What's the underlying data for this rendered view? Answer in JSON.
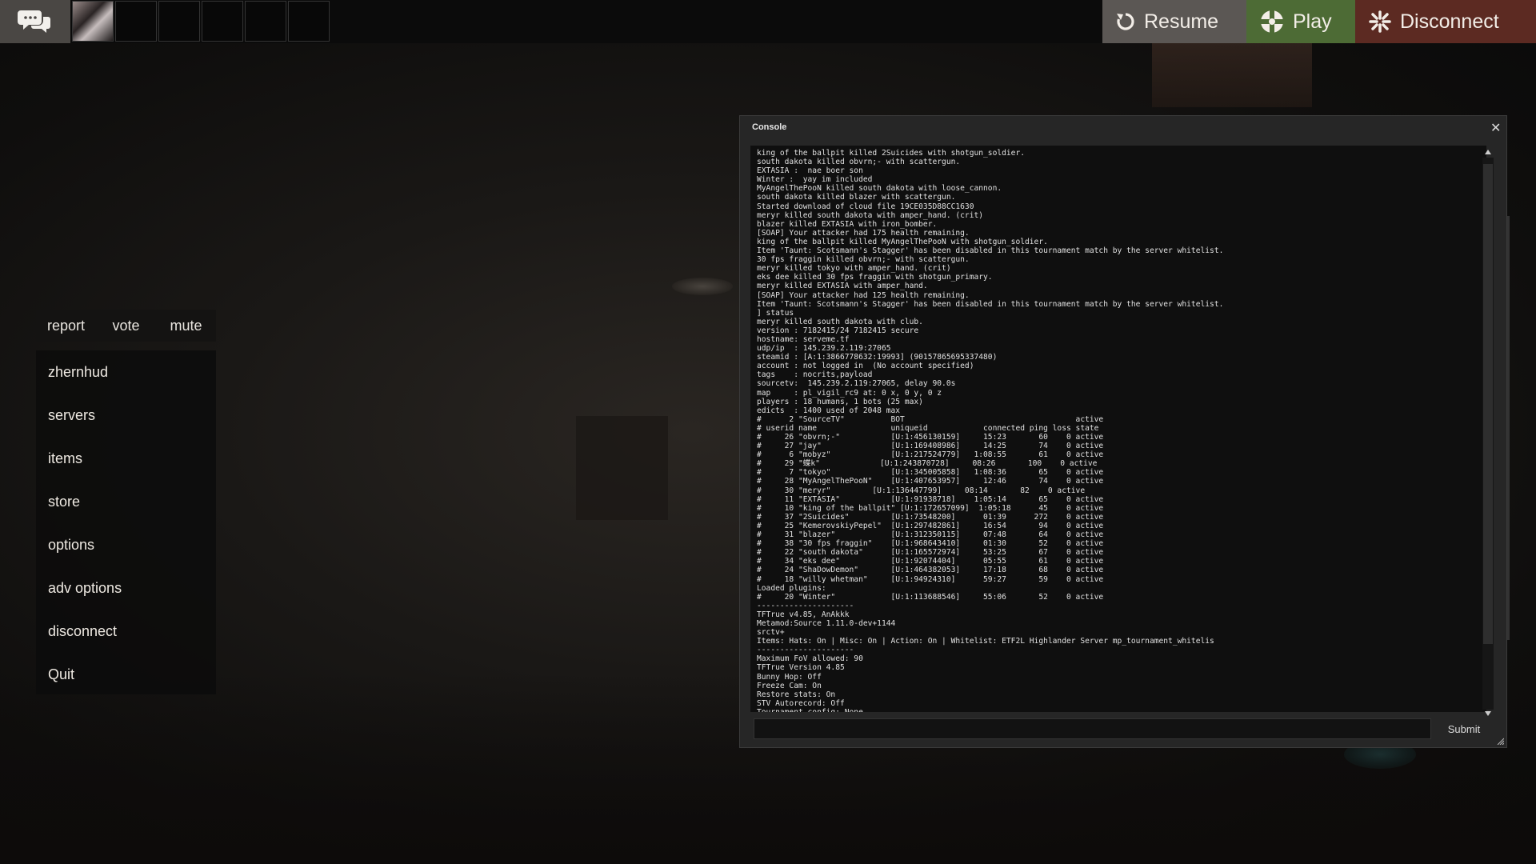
{
  "topbar": {
    "resume_label": "Resume",
    "play_label": "Play",
    "disconnect_label": "Disconnect"
  },
  "quick_actions": [
    "report",
    "vote",
    "mute"
  ],
  "menu": {
    "items": [
      "zhernhud",
      "servers",
      "items",
      "store",
      "options",
      "adv options",
      "disconnect",
      "Quit"
    ]
  },
  "console": {
    "title": "Console",
    "close_glyph": "✕",
    "submit_label": "Submit",
    "input_value": "",
    "lines": [
      "king of the ballpit killed 2Suicides with shotgun_soldier.",
      "south dakota killed obvrn;- with scattergun.",
      "EXTASIA :  nae boer son",
      "Winter :  yay im included",
      "MyAngelThePooN killed south dakota with loose_cannon.",
      "south dakota killed blazer with scattergun.",
      "Started download of cloud file 19CE035D88CC1630",
      "meryr killed south dakota with amper_hand. (crit)",
      "blazer killed EXTASIA with iron_bomber.",
      "[SOAP] Your attacker had 175 health remaining.",
      "king of the ballpit killed MyAngelThePooN with shotgun_soldier.",
      "Item 'Taunt: Scotsmann's Stagger' has been disabled in this tournament match by the server whitelist.",
      "30 fps fraggin killed obvrn;- with scattergun.",
      "meryr killed tokyo with amper_hand. (crit)",
      "eks dee killed 30 fps fraggin with shotgun_primary.",
      "meryr killed EXTASIA with amper_hand.",
      "[SOAP] Your attacker had 125 health remaining.",
      "Item 'Taunt: Scotsmann's Stagger' has been disabled in this tournament match by the server whitelist.",
      "] status",
      "meryr killed south dakota with club.",
      "version : 7182415/24 7182415 secure",
      "hostname: serveme.tf",
      "udp/ip  : 145.239.2.119:27065",
      "steamid : [A:1:3866778632:19993] (90157865695337480)",
      "account : not logged in  (No account specified)",
      "tags    : nocrits,payload",
      "sourcetv:  145.239.2.119:27065, delay 90.0s",
      "map     : pl_vigil_rc9 at: 0 x, 0 y, 0 z",
      "players : 18 humans, 1 bots (25 max)",
      "edicts  : 1400 used of 2048 max",
      "#      2 \"SourceTV\"          BOT                                     active",
      "# userid name                uniqueid            connected ping loss state",
      "#     26 \"obvrn;-\"           [U:1:456130159]     15:23       60    0 active",
      "#     27 \"jay\"               [U:1:169408986]     14:25       74    0 active",
      "#      6 \"mobyz\"             [U:1:217524779]   1:08:55       61    0 active",
      "#     29 \"蝶k\"             [U:1:243870728]     08:26       100    0 active",
      "#      7 \"tokyo\"             [U:1:345005858]   1:08:36       65    0 active",
      "#     28 \"MyAngelThePooN\"    [U:1:407653957]     12:46       74    0 active",
      "#     30 \"meryr\"         [U:1:136447799]     08:14       82    0 active",
      "#     11 \"EXTASIA\"           [U:1:91938718]    1:05:14       65    0 active",
      "#     10 \"king of the ballpit\" [U:1:172657099]  1:05:18      45    0 active",
      "#     37 \"2Suicides\"         [U:1:73548200]      01:39      272    0 active",
      "#     25 \"KemerovskiyPepel\"  [U:1:297482861]     16:54       94    0 active",
      "#     31 \"blazer\"            [U:1:312350115]     07:48       64    0 active",
      "#     38 \"30 fps fraggin\"    [U:1:968643410]     01:30       52    0 active",
      "#     22 \"south dakota\"      [U:1:165572974]     53:25       67    0 active",
      "#     34 \"eks dee\"           [U:1:92074404]      05:55       61    0 active",
      "#     24 \"ShaDowDemon\"       [U:1:464382053]     17:18       68    0 active",
      "#     18 \"willy whetman\"     [U:1:94924310]      59:27       59    0 active",
      "Loaded plugins:",
      "#     20 \"Winter\"            [U:1:113688546]     55:06       52    0 active",
      "---------------------",
      "TFTrue v4.85, AnAkkk",
      "Metamod:Source 1.11.0-dev+1144",
      "srctv+",
      "Items: Hats: On | Misc: On | Action: On | Whitelist: ETF2L Highlander Server mp_tournament_whitelis",
      "---------------------",
      "Maximum FoV allowed: 90",
      "TFTrue Version 4.85",
      "Bunny Hop: Off",
      "Freeze Cam: On",
      "Restore stats: On",
      "STV Autorecord: Off",
      "Tournament config: None"
    ]
  }
}
